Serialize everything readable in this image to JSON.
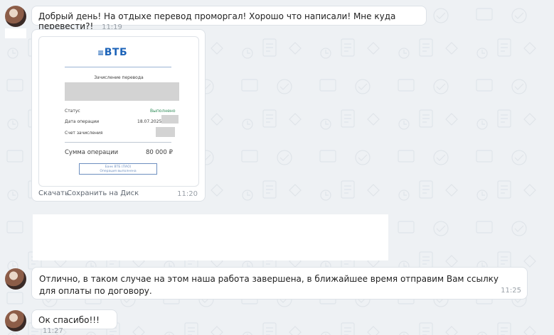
{
  "messages": [
    {
      "text": "Добрый день! На отдыхе перевод проморгал! Хорошо что написали! Мне куда перевести?!",
      "time": "11:19"
    },
    {
      "text": "Отлично, в таком случае на этом наша работа завершена, в ближайшее время отправим Вам ссылку для оплаты по договору.",
      "time": "11:25"
    },
    {
      "text": "Ок спасибо!!!",
      "time": "11:27"
    }
  ],
  "attachment": {
    "time": "11:20",
    "actions": {
      "download": "Скачать",
      "save_to_disk": "Сохранить на Диск"
    },
    "receipt": {
      "logo": "ВТБ",
      "title": "Зачисление перевода",
      "status_label": "Статус",
      "status_value": "Выполнено",
      "date_label": "Дата операции",
      "date_value": "18.07.2025,",
      "account_label": "Счет зачисления",
      "sum_label": "Сумма операции",
      "sum_value": "80 000 ₽",
      "stamp_line1": "Банк ВТБ (ПАО)",
      "stamp_line2": "Операция выполнена"
    }
  },
  "colors": {
    "vtb_blue": "#1c63b8",
    "status_green": "#2e8b57"
  }
}
